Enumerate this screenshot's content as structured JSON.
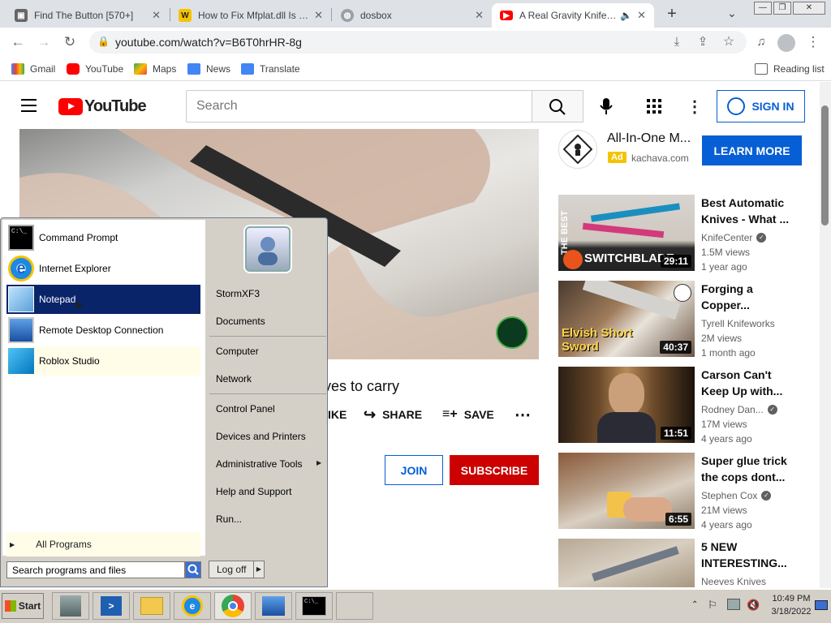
{
  "browser": {
    "tabs": [
      {
        "title": "Find The Button [570+]",
        "favicon": "roblox-icon"
      },
      {
        "title": "How to Fix Mfplat.dll Is Mis",
        "favicon": "wiki-w-icon"
      },
      {
        "title": "dosbox",
        "favicon": "globe-icon"
      },
      {
        "title": "A Real Gravity Knife or",
        "favicon": "youtube-icon"
      }
    ],
    "new_tab": "+",
    "url": "youtube.com/watch?v=B6T0hrHR-8g",
    "bookmarks": [
      "Gmail",
      "YouTube",
      "Maps",
      "News",
      "Translate"
    ],
    "reading_list": "Reading list"
  },
  "youtube": {
    "logo_text": "YouTube",
    "search_placeholder": "Search",
    "sign_in": "SIGN IN",
    "video_title_partial": "ives to carry",
    "actions": {
      "like": "IKE",
      "share": "SHARE",
      "save": "SAVE"
    },
    "join": "JOIN",
    "subscribe": "SUBSCRIBE",
    "ad": {
      "title": "All-In-One M...",
      "badge": "Ad",
      "domain": "kachava.com",
      "cta": "LEARN MORE"
    },
    "recommendations": [
      {
        "title": "Best Automatic Knives - What ...",
        "channel": "KnifeCenter",
        "verified": true,
        "views": "1.5M views",
        "age": "1 year ago",
        "duration": "29:11",
        "thumb_text": "SWITCHBLADE",
        "side_text": "THE BEST"
      },
      {
        "title": "Forging a Copper...",
        "channel": "Tyrell Knifeworks",
        "verified": false,
        "views": "2M views",
        "age": "1 month ago",
        "duration": "40:37",
        "thumb_text": "Elvish Short Sword"
      },
      {
        "title": "Carson Can't Keep Up with...",
        "channel": "Rodney Dan...",
        "verified": true,
        "views": "17M views",
        "age": "4 years ago",
        "duration": "11:51"
      },
      {
        "title": "Super glue trick the cops dont...",
        "channel": "Stephen Cox",
        "verified": true,
        "views": "21M views",
        "age": "4 years ago",
        "duration": "6:55"
      },
      {
        "title": "5 NEW INTERESTING...",
        "channel": "Neeves Knives",
        "verified": false,
        "views": "",
        "age": "",
        "duration": ""
      }
    ]
  },
  "start_menu": {
    "programs": [
      {
        "label": "Command Prompt",
        "icon": "cmd-icon"
      },
      {
        "label": "Internet Explorer",
        "icon": "ie-icon"
      },
      {
        "label": "Notepad",
        "icon": "notepad-icon",
        "selected": true
      },
      {
        "label": "Remote Desktop Connection",
        "icon": "rdp-icon"
      },
      {
        "label": "Roblox Studio",
        "icon": "roblox-studio-icon",
        "pinned": true
      }
    ],
    "right_items": [
      "StormXF3",
      "Documents",
      "Computer",
      "Network",
      "Control Panel",
      "Devices and Printers",
      "Administrative Tools",
      "Help and Support",
      "Run..."
    ],
    "all_programs": "All Programs",
    "search_placeholder": "Search programs and files",
    "log_off": "Log off"
  },
  "taskbar": {
    "start": "Start",
    "time": "10:49 PM",
    "date": "3/18/2022"
  },
  "colors": {
    "yt_red": "#ff0000",
    "yt_blue": "#065fd4",
    "subscribe_red": "#cc0000",
    "start_select": "#0a246a"
  }
}
